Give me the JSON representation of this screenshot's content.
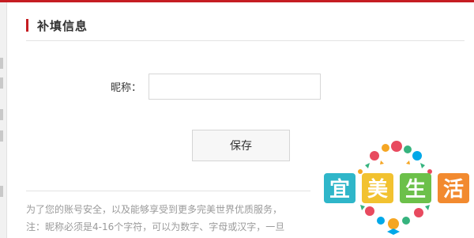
{
  "section": {
    "title": "补填信息"
  },
  "form": {
    "nickname_label": "昵称：",
    "nickname_value": "",
    "save_label": "保存"
  },
  "notes": [
    "为了您的账号安全，以及能够享受到更多完美世界优质服务，",
    "注：昵称必须是4-16个字符，可以为数字、字母或汉字，一旦"
  ],
  "watermark": {
    "text": "宜美生活"
  },
  "colors": {
    "accent": "#c51d22",
    "note_text": "#9a9a9a"
  }
}
